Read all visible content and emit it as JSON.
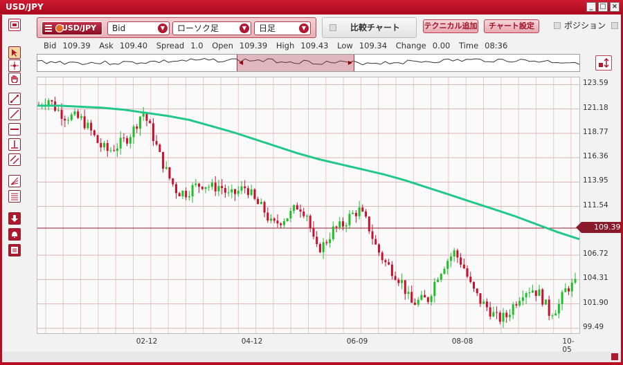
{
  "window": {
    "title": "USD/JPY",
    "controls": [
      "_",
      "□",
      "×"
    ]
  },
  "toolbar": {
    "symbol": "USD/JPY",
    "price_type": "Bid",
    "chart_type": "ローソク足",
    "period": "日足",
    "compare_label": "比較チャート",
    "add_technical_label": "テクニカル追加",
    "chart_settings_label": "チャート設定",
    "position_label": "ポジション"
  },
  "quote": {
    "bid_label": "Bid",
    "bid": "109.39",
    "ask_label": "Ask",
    "ask": "109.40",
    "spread_label": "Spread",
    "spread": "1.0",
    "open_label": "Open",
    "open": "109.39",
    "high_label": "High",
    "high": "109.43",
    "low_label": "Low",
    "low": "109.34",
    "change_label": "Change",
    "change": "0.00",
    "time_label": "Time",
    "time": "08:36"
  },
  "chart_data": {
    "type": "candlestick",
    "y_ticks": [
      "123.59",
      "121.18",
      "118.77",
      "116.36",
      "113.95",
      "111.54",
      "106.72",
      "104.31",
      "101.90",
      "99.49"
    ],
    "ylim": [
      99.0,
      124.3
    ],
    "x_ticks": [
      "02-12",
      "04-12",
      "06-09",
      "08-08",
      "10-05"
    ],
    "current_price": "109.39",
    "current_price_value": 109.39,
    "close_path": [
      121.5,
      122.3,
      121.2,
      120.5,
      120.4,
      120.1,
      119.0,
      117.6,
      117.0,
      117.5,
      118.1,
      119.2,
      121.0,
      119.0,
      116.5,
      114.5,
      113.0,
      112.9,
      113.5,
      113.8,
      113.4,
      113.6,
      112.5,
      113.0,
      113.5,
      112.0,
      111.2,
      109.6,
      110.2,
      110.7,
      111.7,
      110.8,
      107.2,
      107.8,
      109.2,
      109.6,
      110.6,
      111.2,
      109.8,
      107.5,
      106.0,
      105.1,
      104.0,
      101.9,
      102.2,
      102.4,
      104.6,
      106.0,
      107.0,
      105.8,
      103.5,
      102.2,
      101.4,
      100.4,
      100.6,
      102.0,
      103.2,
      103.4,
      102.8,
      101.0,
      101.6,
      103.5,
      103.8
    ],
    "ma_path": [
      121.5,
      121.5,
      121.4,
      121.3,
      121.1,
      120.8,
      120.5,
      120.1,
      119.5,
      118.9,
      118.2,
      117.5,
      116.8,
      116.2,
      115.7,
      115.2,
      114.7,
      114.1,
      113.4,
      112.7,
      112.0,
      111.3,
      110.6,
      109.8,
      109.0,
      108.3
    ]
  },
  "colors": {
    "up": "#1fbf2a",
    "down": "#c8102e",
    "ma": "#22c88a",
    "accent": "#b80c22",
    "price_line": "#9a1b2e"
  },
  "sidebar": {
    "tools": [
      "cursor-icon",
      "crosshair-icon",
      "hand-icon",
      "trendline-icon",
      "line-icon",
      "horizontal-line-icon",
      "vertical-line-icon",
      "channel-icon",
      "fibonacci-icon",
      "text-icon",
      "download-icon",
      "alert-icon",
      "list-icon"
    ]
  }
}
